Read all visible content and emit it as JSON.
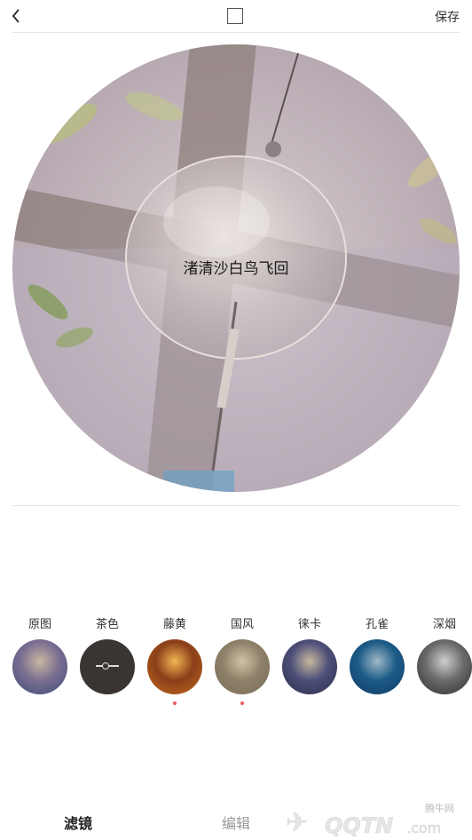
{
  "header": {
    "save_label": "保存"
  },
  "photo": {
    "caption": "渚清沙白鸟飞回"
  },
  "filters": [
    {
      "name": "原图",
      "dot": false,
      "palette": [
        "#3b4a78",
        "#c8b6a2",
        "#7b6f91"
      ]
    },
    {
      "name": "茶色",
      "dot": false,
      "palette": [
        "#3a3532",
        "#3a3532",
        "#3a3532"
      ]
    },
    {
      "name": "藤黄",
      "dot": true,
      "palette": [
        "#c46a1f",
        "#f2b552",
        "#8a3f19"
      ]
    },
    {
      "name": "国风",
      "dot": true,
      "palette": [
        "#7a6c55",
        "#cfc3a6",
        "#8e8169"
      ]
    },
    {
      "name": "徕卡",
      "dot": false,
      "palette": [
        "#2b2c4a",
        "#c7b89e",
        "#4d4f79"
      ]
    },
    {
      "name": "孔雀",
      "dot": false,
      "palette": [
        "#123c66",
        "#a0b8c8",
        "#1c5b86"
      ]
    },
    {
      "name": "深烟",
      "dot": false,
      "palette": [
        "#2f2f2f",
        "#cfcfcf",
        "#6a6a6a"
      ]
    }
  ],
  "tabs": {
    "filter_label": "滤镜",
    "edit_label": "编辑"
  },
  "watermark": {
    "site": "腾牛网",
    "brand": "QQTN",
    "domain": ".com"
  }
}
